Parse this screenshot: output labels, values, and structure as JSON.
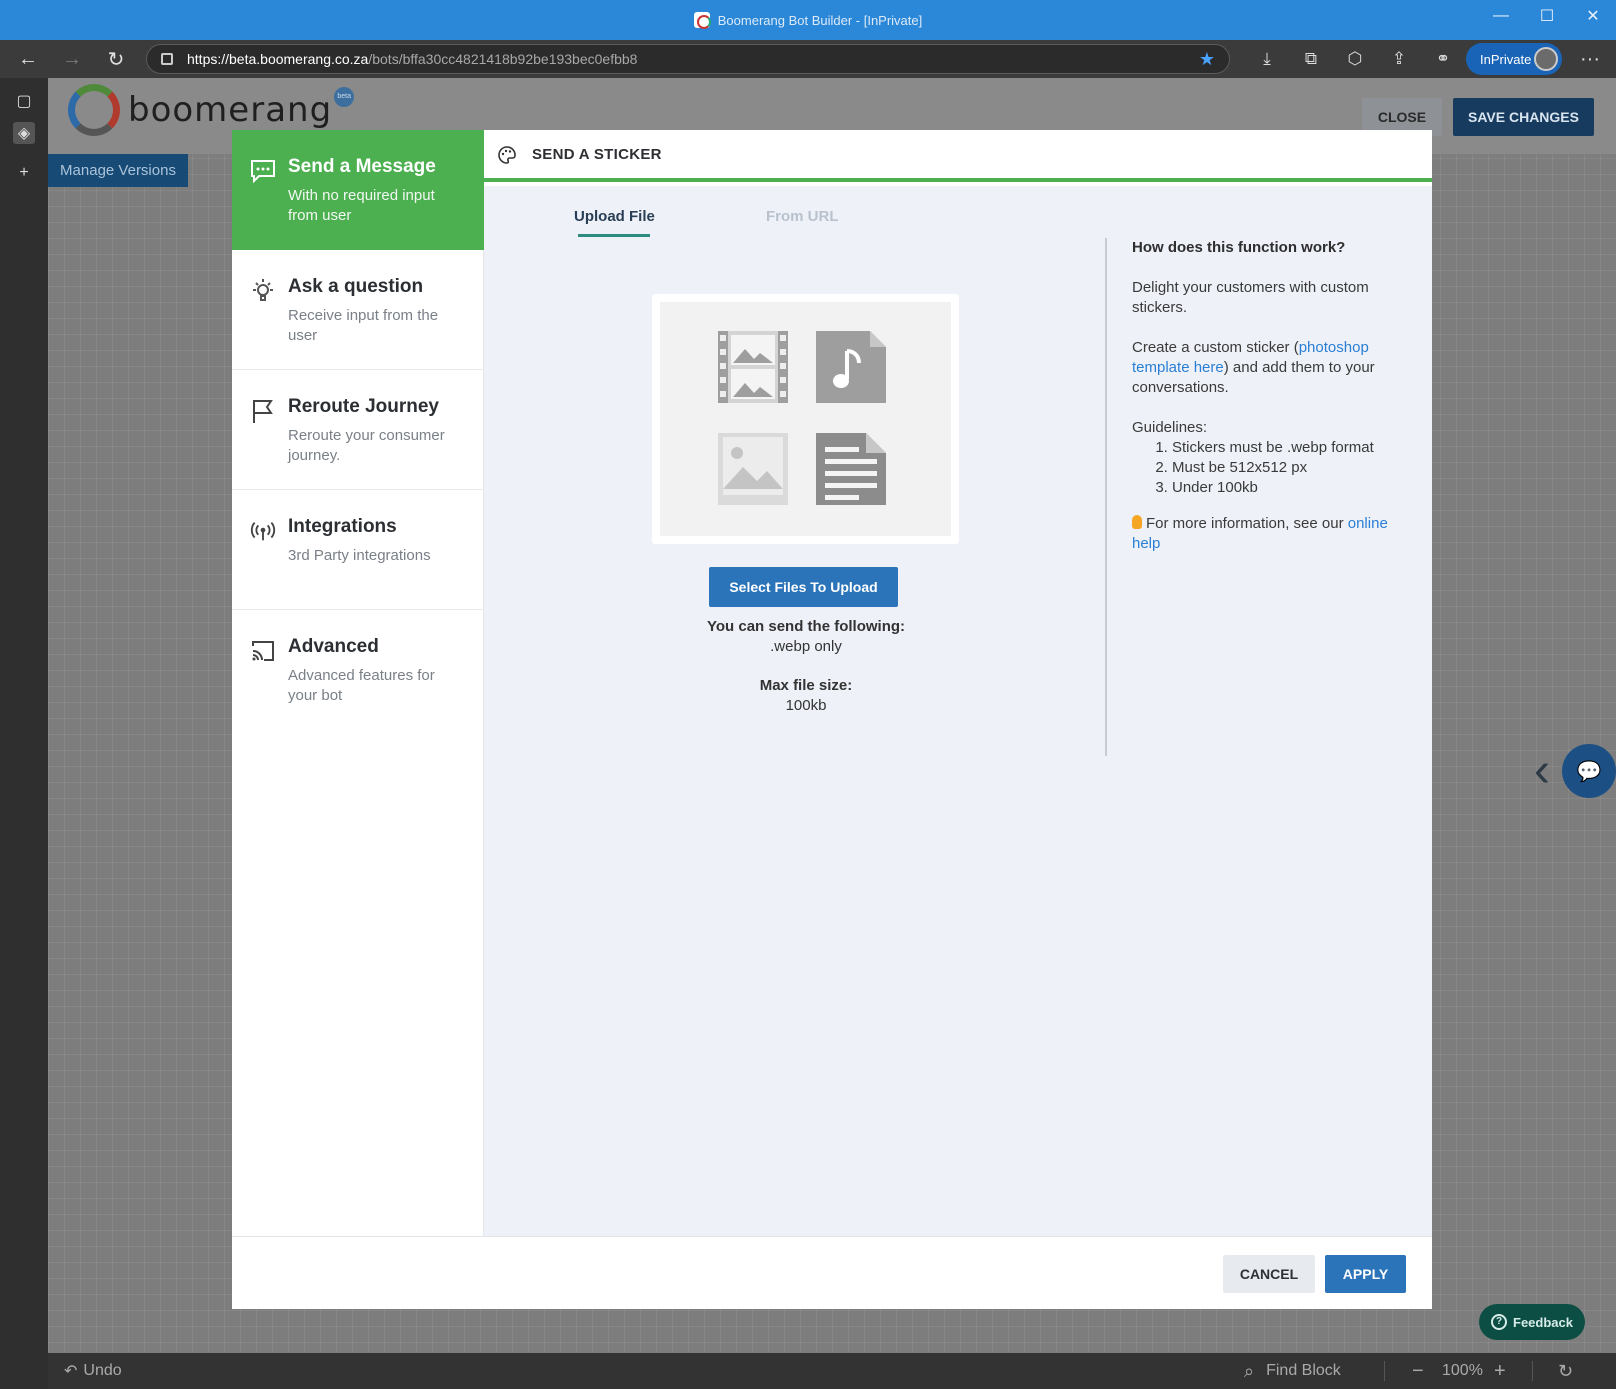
{
  "window": {
    "title": "Boomerang Bot Builder - [InPrivate]",
    "minimize_glyph": "—",
    "maximize_glyph": "☐",
    "close_glyph": "✕"
  },
  "browser": {
    "url_host": "https://beta.boomerang.co.za",
    "url_path": "/bots/bffa30cc4821418b92be193bec0efbb8",
    "inprivate_label": "InPrivate",
    "more_glyph": "···"
  },
  "app": {
    "logo_text": "boomerang",
    "logo_badge": "beta",
    "close_label": "CLOSE",
    "save_label": "SAVE CHANGES",
    "manage_versions_label": "Manage Versions",
    "feedback_label": "Feedback",
    "bottom": {
      "undo_label": "Undo",
      "find_block_label": "Find Block",
      "zoom_level": "100%"
    }
  },
  "modal": {
    "sidebar": [
      {
        "title": "Send a Message",
        "subtitle": "With no required input from user",
        "icon": "chat-icon",
        "active": true
      },
      {
        "title": "Ask a question",
        "subtitle": "Receive input from the user",
        "icon": "lightbulb-icon",
        "active": false
      },
      {
        "title": "Reroute Journey",
        "subtitle": "Reroute your consumer journey.",
        "icon": "flag-icon",
        "active": false
      },
      {
        "title": "Integrations",
        "subtitle": "3rd Party integrations",
        "icon": "broadcast-icon",
        "active": false
      },
      {
        "title": "Advanced",
        "subtitle": "Advanced features for your bot",
        "icon": "cast-icon",
        "active": false
      }
    ],
    "header_title": "SEND A STICKER",
    "tabs": {
      "upload": "Upload File",
      "url": "From URL"
    },
    "upload_button": "Select Files To Upload",
    "send_following_label": "You can send the following:",
    "send_following_value": ".webp only",
    "max_size_label": "Max file size:",
    "max_size_value": "100kb",
    "help": {
      "title": "How does this function work?",
      "intro": "Delight your customers with custom stickers.",
      "create_prefix": "Create a custom sticker (",
      "create_link": "photoshop template here",
      "create_suffix": ") and add them to your conversations.",
      "guidelines_label": "Guidelines:",
      "guidelines": [
        "Stickers must be .webp format",
        "Must be 512x512 px",
        "Under 100kb"
      ],
      "more_info_prefix": "For more information, see our ",
      "more_info_link": "online help"
    },
    "cancel_label": "CANCEL",
    "apply_label": "APPLY"
  },
  "colors": {
    "accent_green": "#4caf50",
    "primary_blue": "#2b74b9",
    "titlebar_blue": "#2b88d8"
  }
}
